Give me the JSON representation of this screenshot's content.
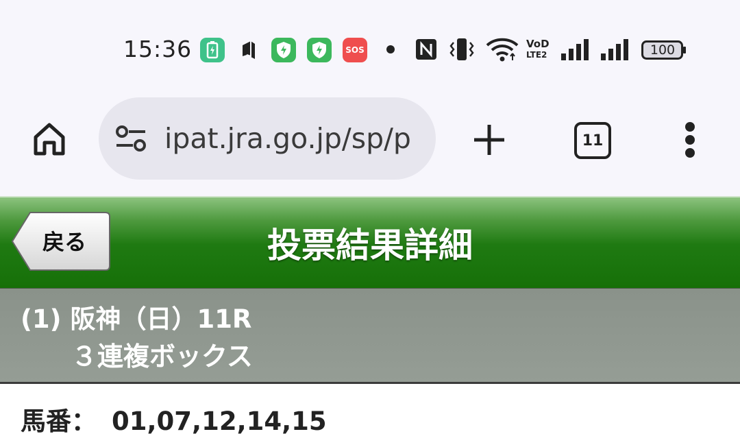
{
  "status_bar": {
    "time": "15:36",
    "battery_level": "100",
    "icons": [
      "battery-saver-icon",
      "app-icon",
      "shield-app-icon",
      "shield-app-icon",
      "sos-icon",
      "dot-icon",
      "nfc-icon",
      "vibrate-icon",
      "wifi-icon",
      "volte-icon",
      "signal-icon",
      "signal-icon",
      "battery-icon"
    ],
    "sos_label": "SOS",
    "volte_label_top": "VoD",
    "volte_label_bottom": "LTE2"
  },
  "browser": {
    "url": "ipat.jra.go.jp/sp/p",
    "tab_count": "11"
  },
  "header": {
    "back_label": "戻る",
    "title": "投票結果詳細",
    "accent_color": "#1f7a12"
  },
  "race": {
    "line": "(1) 阪神（日）11R",
    "bet_type": "３連複ボックス"
  },
  "horses": {
    "label": "馬番：",
    "numbers": "01,07,12,14,15"
  }
}
